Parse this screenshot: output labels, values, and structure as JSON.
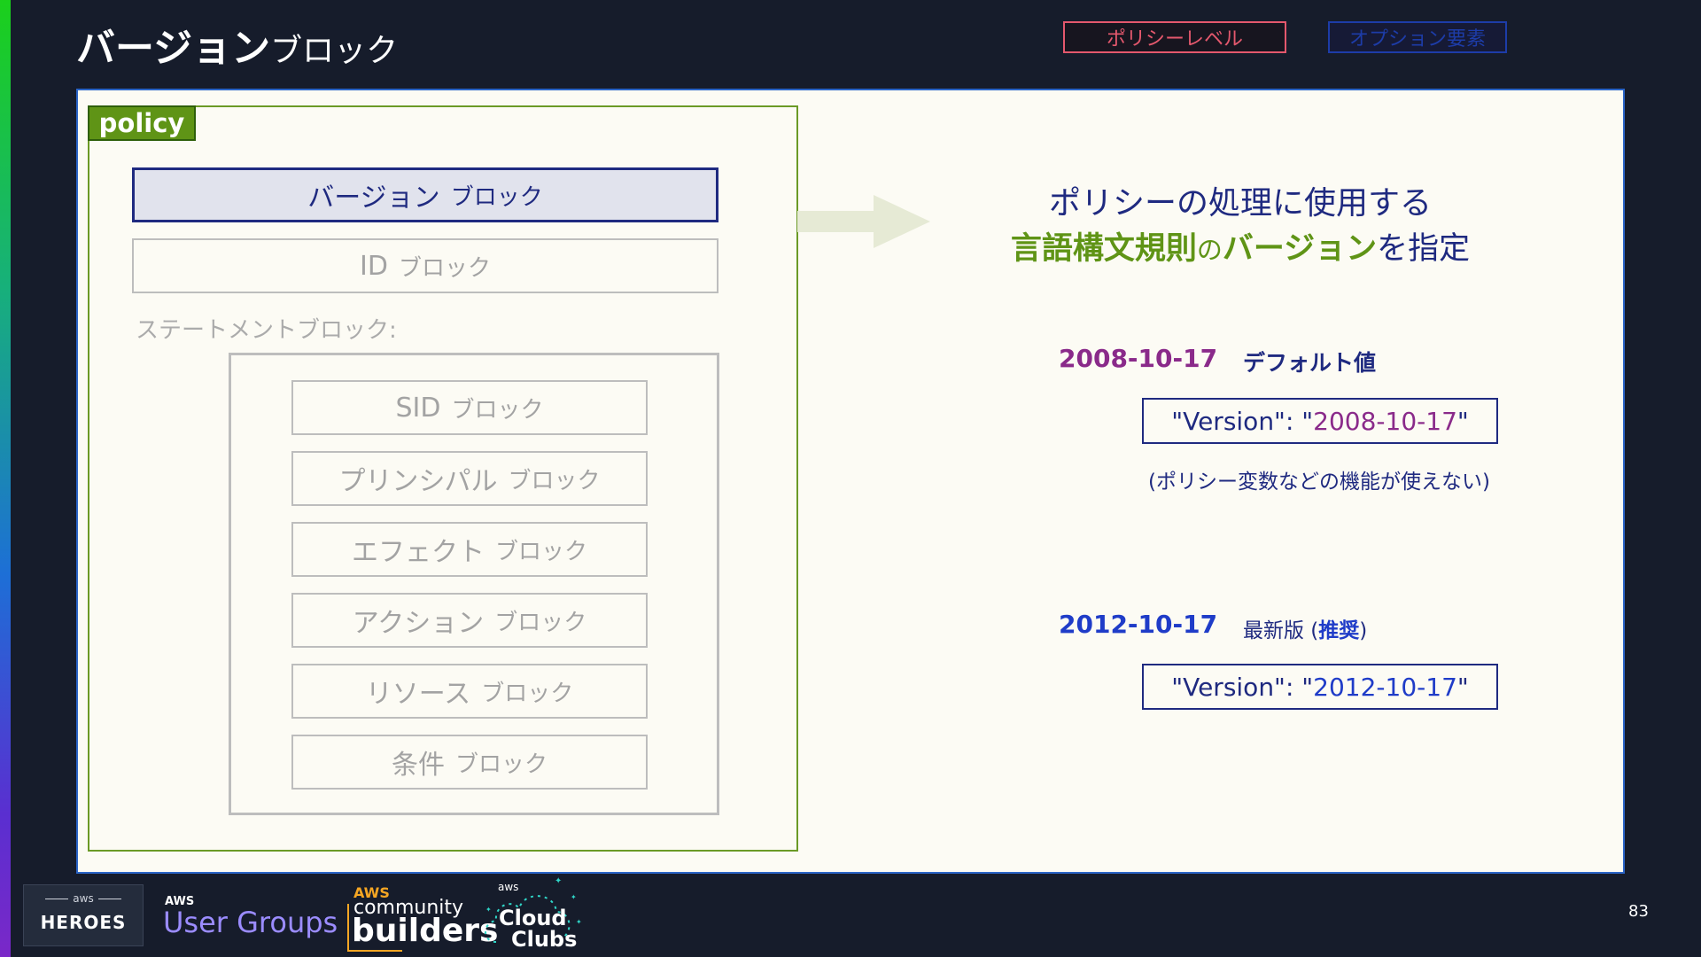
{
  "slide": {
    "title_bold": "バージョン",
    "title_normal": "ブロック",
    "page_number": "83"
  },
  "tags": {
    "policy_level": "ポリシーレベル",
    "option_elements": "オプション要素"
  },
  "policy": {
    "label": "policy",
    "version_block": {
      "main": "バージョン",
      "sub": "ブロック"
    },
    "id_block": {
      "main": "ID",
      "sub": "ブロック"
    },
    "statement_label": "ステートメントブロック:",
    "statement_blocks": [
      {
        "main": "SID",
        "sub": "ブロック"
      },
      {
        "main": "プリンシパル",
        "sub": "ブロック"
      },
      {
        "main": "エフェクト",
        "sub": "ブロック"
      },
      {
        "main": "アクション",
        "sub": "ブロック"
      },
      {
        "main": "リソース",
        "sub": "ブロック"
      },
      {
        "main": "条件",
        "sub": "ブロック"
      }
    ]
  },
  "description": {
    "line1": "ポリシーの処理に使用する",
    "line2_part1": "言語構文規則",
    "line2_part2": "の",
    "line2_part3": "バージョン",
    "line2_part4": "を指定"
  },
  "versions": {
    "v1_date": "2008-10-17",
    "v1_note": "デフォルト値",
    "v1_code_key": "\"Version\": \"",
    "v1_code_value": "2008-10-17",
    "v1_code_end": "\"",
    "v1_caveat": "(ポリシー変数などの機能が使えない)",
    "v2_date": "2012-10-17",
    "v2_note_a": "最新版 (",
    "v2_note_b": "推奨",
    "v2_note_c": ")",
    "v2_code_key": "\"Version\": \"",
    "v2_code_value": "2012-10-17",
    "v2_code_end": "\""
  },
  "footer": {
    "heroes_aws": "aws",
    "heroes_label": "HEROES",
    "user_groups_aws": "AWS",
    "user_groups_label": "User Groups",
    "cb_aws": "AWS",
    "cb_community": "community",
    "cb_builders": "builders",
    "cloud_clubs_aws": "aws",
    "cloud_clubs_line1": "Cloud",
    "cloud_clubs_line2": "Clubs"
  },
  "colors": {
    "background": "#161c2b",
    "panel": "#fcfbf4",
    "policy_green": "#5f9416",
    "navy": "#1f2a80",
    "purple_2008": "#8a2a8a",
    "blue_2012": "#1f3cc8",
    "tag_red": "#e4586d"
  }
}
